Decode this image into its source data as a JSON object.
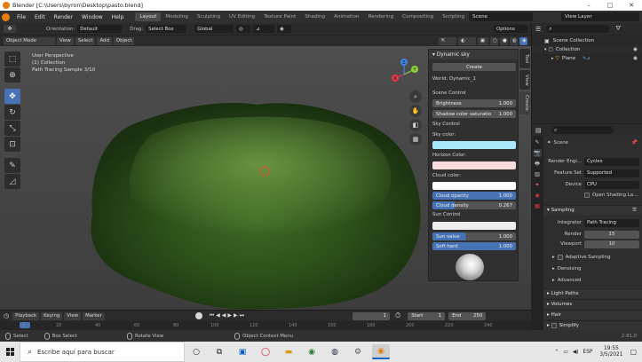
{
  "window": {
    "title": "Blender [C:\\Users\\byron\\Desktop\\pasto.blend]",
    "min": "–",
    "max": "□",
    "close": "✕"
  },
  "menu": [
    "File",
    "Edit",
    "Render",
    "Window",
    "Help"
  ],
  "workspaces": [
    "Layout",
    "Modeling",
    "Sculpting",
    "UV Editing",
    "Texture Paint",
    "Shading",
    "Animation",
    "Rendering",
    "Compositing",
    "Scripting",
    "+"
  ],
  "scene": "Scene",
  "view_layer": "View Layer",
  "tool_settings": {
    "orientation_label": "Orientation:",
    "orientation": "Default",
    "drag_label": "Drag:",
    "drag": "Select Box",
    "transform": "Global",
    "options": "Options"
  },
  "viewport_header": {
    "mode": "Object Mode",
    "menus": [
      "View",
      "Select",
      "Add",
      "Object"
    ]
  },
  "viewport_info": [
    "User Perspective",
    "(1) Collection",
    "Path Tracing Sample 3/10"
  ],
  "gizmo": {
    "y": "Y",
    "x": "X",
    "z": "Z"
  },
  "side_tabs": [
    "Tool",
    "View",
    "Create"
  ],
  "dynamic_sky": {
    "title": "Dynamic sky",
    "create": "Create",
    "world": "World: Dynamic_1",
    "scene_control": "Scene Control",
    "brightness_label": "Brightness",
    "brightness": "1.000",
    "shadow_label": "Shadow color saturatio",
    "shadow": "1.000",
    "sky_control": "Sky Control",
    "sky_color": "Sky color:",
    "horizon_color": "Horizon Color:",
    "cloud_color": "Cloud color:",
    "cloud_opacity_label": "Cloud opacity",
    "cloud_opacity": "1.000",
    "cloud_density_label": "Cloud density",
    "cloud_density": "0.267",
    "sun_control": "Sun Control",
    "sun_value_label": "Sun value",
    "sun_value": "1.000",
    "soft_hard_label": "Soft hard",
    "soft_hard": "1.000",
    "colors": {
      "sky": "#a9e8fb",
      "horizon": "#f7dcdc",
      "cloud": "#ffffff",
      "sun": "#eeeeee"
    }
  },
  "timeline": {
    "menus": [
      "Playback",
      "Keying",
      "View",
      "Marker"
    ],
    "current": "1",
    "start_label": "Start",
    "start": "1",
    "end_label": "End",
    "end": "250",
    "ticks": [
      "0",
      "20",
      "40",
      "60",
      "80",
      "100",
      "120",
      "140",
      "160",
      "180",
      "200",
      "220",
      "240"
    ]
  },
  "status": {
    "select": "Select",
    "box": "Box Select",
    "rotate": "Rotate View",
    "context": "Object Context Menu",
    "version": "2.91.0"
  },
  "outliner": {
    "title": "Scene Collection",
    "collection": "Collection",
    "plane": "Plane"
  },
  "properties": {
    "scene": "Scene",
    "render_engine_label": "Render Engi...",
    "render_engine": "Cycles",
    "feature_set_label": "Feature Set",
    "feature_set": "Supported",
    "device_label": "Device",
    "device": "CPU",
    "open_shading": "Open Shading La...",
    "sampling": "Sampling",
    "integrator_label": "Integrator",
    "integrator": "Path Tracing",
    "render_label": "Render",
    "render": "15",
    "viewport_label": "Viewport",
    "viewport": "10",
    "adaptive": "Adaptive Sampling",
    "denoising": "Denoising",
    "advanced": "Advanced",
    "light_paths": "Light Paths",
    "volumes": "Volumes",
    "hair": "Hair",
    "simplify": "Simplify"
  },
  "taskbar": {
    "search_placeholder": "Escribe aquí para buscar",
    "lang": "ESP",
    "time": "19:55",
    "date": "3/5/2021"
  }
}
